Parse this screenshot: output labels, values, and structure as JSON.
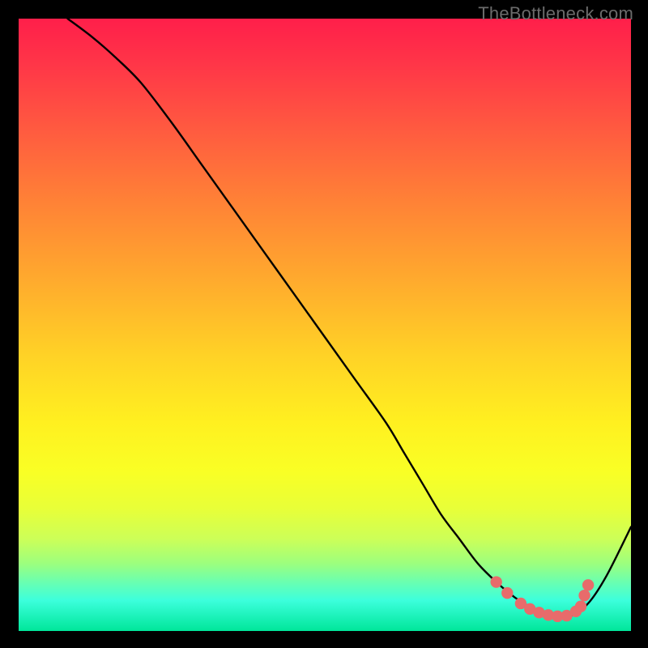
{
  "watermark": "TheBottleneck.com",
  "chart_data": {
    "type": "line",
    "title": "",
    "xlabel": "",
    "ylabel": "",
    "xlim": [
      0,
      100
    ],
    "ylim": [
      0,
      100
    ],
    "series": [
      {
        "name": "bottleneck-curve",
        "x": [
          8,
          12,
          16,
          20,
          25,
          30,
          35,
          40,
          45,
          50,
          55,
          60,
          63,
          66,
          69,
          72,
          75,
          78,
          81,
          84,
          87,
          90,
          93,
          96,
          100
        ],
        "y": [
          100,
          97,
          93.5,
          89.5,
          83,
          76,
          69,
          62,
          55,
          48,
          41,
          34,
          29,
          24,
          19,
          15,
          11,
          8,
          5.5,
          3.7,
          2.7,
          2.4,
          4.5,
          9,
          17
        ]
      }
    ],
    "markers": {
      "name": "highlight-points",
      "color": "#e86b6b",
      "points": [
        {
          "x": 78.0,
          "y": 8.0
        },
        {
          "x": 79.8,
          "y": 6.2
        },
        {
          "x": 82.0,
          "y": 4.5
        },
        {
          "x": 83.5,
          "y": 3.6
        },
        {
          "x": 85.0,
          "y": 3.0
        },
        {
          "x": 86.5,
          "y": 2.6
        },
        {
          "x": 88.0,
          "y": 2.4
        },
        {
          "x": 89.5,
          "y": 2.5
        },
        {
          "x": 91.0,
          "y": 3.2
        },
        {
          "x": 91.8,
          "y": 4.0
        },
        {
          "x": 92.4,
          "y": 5.8
        },
        {
          "x": 93.0,
          "y": 7.5
        }
      ]
    },
    "background": {
      "type": "vertical-gradient",
      "stops": [
        {
          "pos": 0,
          "color": "#ff1f4a"
        },
        {
          "pos": 30,
          "color": "#ff8236"
        },
        {
          "pos": 55,
          "color": "#ffd226"
        },
        {
          "pos": 74,
          "color": "#f9ff25"
        },
        {
          "pos": 89,
          "color": "#9cff7e"
        },
        {
          "pos": 100,
          "color": "#00e69a"
        }
      ]
    }
  }
}
